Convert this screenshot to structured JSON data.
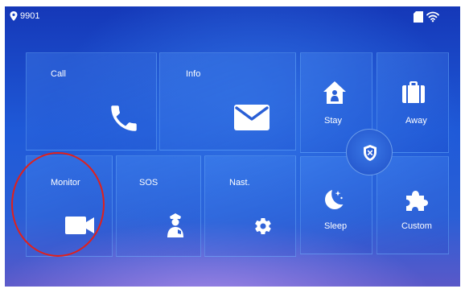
{
  "status": {
    "room_number": "9901",
    "location_icon": "location-pin-icon",
    "sd_card_icon": "sd-card-icon",
    "wifi_icon": "wifi-icon"
  },
  "tiles": {
    "call": {
      "label": "Call",
      "icon": "phone-icon"
    },
    "info": {
      "label": "Info",
      "icon": "envelope-icon"
    },
    "monitor": {
      "label": "Monitor",
      "icon": "video-camera-icon"
    },
    "sos": {
      "label": "SOS",
      "icon": "police-officer-icon"
    },
    "settings": {
      "label": "Nast.",
      "icon": "gear-icon"
    }
  },
  "arming": {
    "stay": {
      "label": "Stay",
      "icon": "home-icon"
    },
    "away": {
      "label": "Away",
      "icon": "briefcase-icon"
    },
    "sleep": {
      "label": "Sleep",
      "icon": "moon-icon"
    },
    "custom": {
      "label": "Custom",
      "icon": "puzzle-icon"
    },
    "center_icon": "shield-icon"
  },
  "annotation": {
    "highlight_color": "#e0201c"
  },
  "colors": {
    "background": "#1f5ad8",
    "icon": "#ffffff"
  }
}
